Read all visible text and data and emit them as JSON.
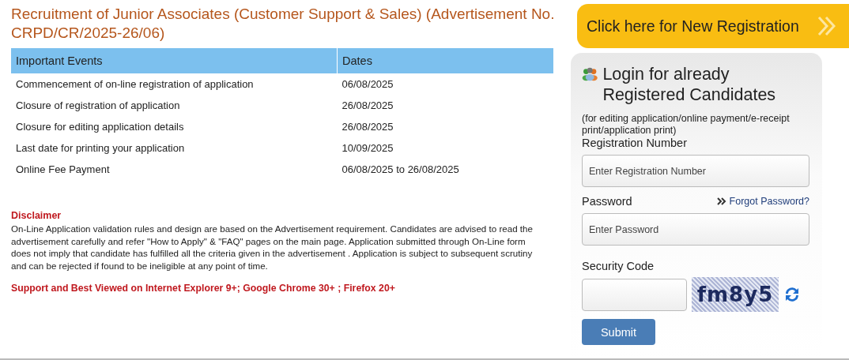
{
  "title": "Recruitment of Junior Associates (Customer Support & Sales) (Advertisement No. CRPD/CR/2025-26/06)",
  "table": {
    "columns": [
      "Important Events",
      "Dates"
    ],
    "rows": [
      [
        "Commencement of on-line registration of application",
        "06/08/2025"
      ],
      [
        "Closure of registration of application",
        "26/08/2025"
      ],
      [
        "Closure for editing application details",
        "26/08/2025"
      ],
      [
        "Last date for printing your application",
        "10/09/2025"
      ],
      [
        "Online Fee Payment",
        "06/08/2025 to 26/08/2025"
      ]
    ]
  },
  "disclaimer": {
    "heading": "Disclaimer",
    "text": "On-Line Application validation rules and design are based on the Advertisement requirement. Candidates are advised to read the advertisement carefully and refer \"How to Apply\" & \"FAQ\" pages on the main page. Application submitted through On-Line form does not imply that candidate has fulfilled all the criteria given in the advertisement . Application is subject to subsequent scrutiny and can be rejected if found to be ineligible at any point of time."
  },
  "browser_note": "Support and Best Viewed on Internet Explorer 9+; Google Chrome 30+ ; Firefox 20+",
  "new_registration": "Click here for New Registration",
  "login": {
    "heading": "Login for already Registered Candidates",
    "note": "(for editing application/online payment/e-receipt print/application print)",
    "registration_label": "Registration Number",
    "registration_placeholder": "Enter Registration Number",
    "password_label": "Password",
    "forgot_link": "Forgot Password?",
    "password_placeholder": "Enter Password",
    "security_label": "Security Code",
    "captcha": "fm8y5",
    "submit": "Submit"
  }
}
